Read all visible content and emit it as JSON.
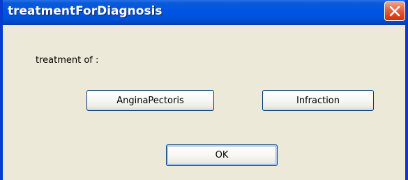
{
  "window": {
    "title": "treatmentForDiagnosis",
    "close_icon": "close-x-icon"
  },
  "dialog": {
    "prompt_label": "treatment of :",
    "buttons": {
      "angina": "AnginaPectoris",
      "infraction": "Infraction",
      "ok": "OK"
    }
  },
  "colors": {
    "titlebar": "#0054e3",
    "close_button": "#e4683f",
    "dialog_background": "#ece9d8",
    "button_border": "#003c74"
  }
}
